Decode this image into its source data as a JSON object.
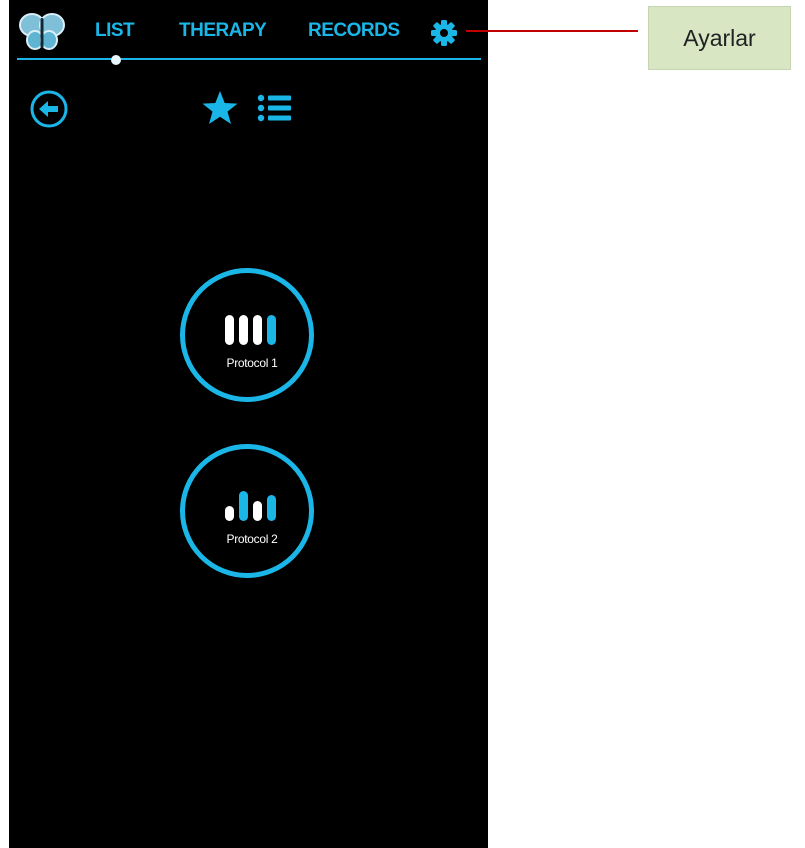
{
  "colors": {
    "accent": "#1bb6e8",
    "background": "#000000",
    "bar_white": "#ffffff",
    "callout_bg": "#d8e6c4",
    "callout_line": "#c00000"
  },
  "header": {
    "logo_icon": "butterfly-logo-icon",
    "tabs": [
      {
        "label": "LIST",
        "active": true
      },
      {
        "label": "THERAPY",
        "active": false
      },
      {
        "label": "RECORDS",
        "active": false
      }
    ],
    "settings_icon": "gear-icon"
  },
  "toolbar": {
    "back_icon": "back-arrow-icon",
    "favorite_icon": "star-icon",
    "list_icon": "list-icon"
  },
  "protocols": [
    {
      "label": "Protocol 1",
      "icon": "equal-bars-icon"
    },
    {
      "label": "Protocol 2",
      "icon": "varied-bars-icon"
    }
  ],
  "annotation": {
    "label": "Ayarlar",
    "target": "settings"
  }
}
